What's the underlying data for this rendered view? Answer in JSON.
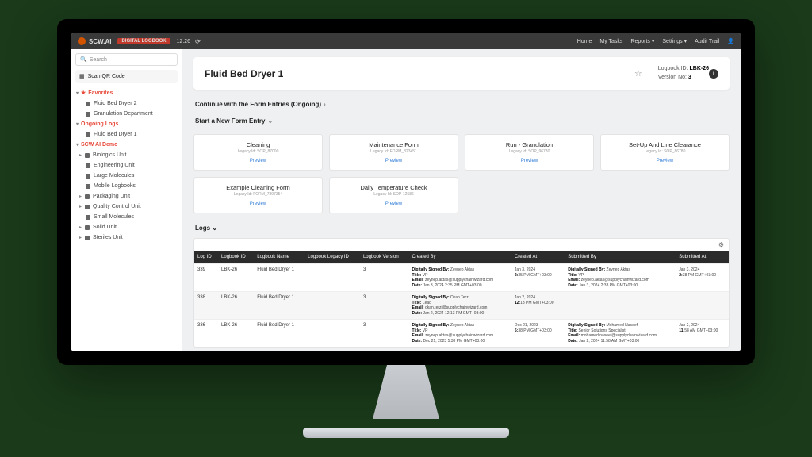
{
  "topbar": {
    "brand": "SCW.AI",
    "badge": "DIGITAL LOGBOOK",
    "time": "12:26",
    "nav": [
      "Home",
      "My Tasks",
      "Reports ▾",
      "Settings ▾",
      "Audit Trail"
    ]
  },
  "sidebar": {
    "search_ph": "Search",
    "qr": "Scan QR Code",
    "sections": [
      {
        "title": "Favorites",
        "items": [
          "Fluid Bed Dryer 2",
          "Granulation Department"
        ]
      },
      {
        "title": "Ongoing Logs",
        "items": [
          "Fluid Bed Dryer 1"
        ]
      },
      {
        "title": "SCW AI Demo",
        "items": []
      }
    ],
    "units": [
      "Biologics Unit",
      "Engineering Unit",
      "Large Molecules",
      "Mobile Logbooks",
      "Packaging Unit",
      "Quality Control Unit",
      "Small Molecules",
      "Solid Unit",
      "Steriles Unit"
    ]
  },
  "header": {
    "title": "Fluid Bed Dryer 1",
    "logbook_id_label": "Logbook ID:",
    "logbook_id": "LBK-26",
    "version_label": "Version No:",
    "version": "3"
  },
  "continue_label": "Continue with the Form Entries (Ongoing)",
  "start_label": "Start a New Form Entry",
  "forms": [
    {
      "t": "Cleaning",
      "s": "Legacy Id: SOP_87000",
      "p": "Preview"
    },
    {
      "t": "Maintenance Form",
      "s": "Legacy Id: FORM_823451",
      "p": "Preview"
    },
    {
      "t": "Run - Granulation",
      "s": "Legacy Id: SOP_96780",
      "p": "Preview"
    },
    {
      "t": "Set-Up And Line Clearance",
      "s": "Legacy Id: SOP_86780",
      "p": "Preview"
    },
    {
      "t": "Example Cleaning Form",
      "s": "Legacy Id: FORM_7897354",
      "p": "Preview"
    },
    {
      "t": "Daily Temperature Check",
      "s": "Legacy Id: SOP-12586",
      "p": "Preview"
    }
  ],
  "logs_label": "Logs",
  "table": {
    "cols": [
      "Log ID",
      "Logbook ID",
      "Logbook Name",
      "Logbook Legacy ID",
      "Logbook Version",
      "Created By",
      "Created At",
      "Submitted By",
      "Submitted At"
    ],
    "rows": [
      {
        "log_id": "339",
        "lbk": "LBK-26",
        "name": "Fluid Bed Dryer 1",
        "legacy": "",
        "ver": "3",
        "cby": "Digitally Signed By: Zeynep Aktas\nTitle: VP\nEmail: zeynep.aktas@supplychainwizard.com\nDate: Jan 3, 2024 2:35 PM GMT+03:00",
        "cat": "Jan 3, 2024\n2:35 PM GMT+03:00",
        "sby": "Digitally Signed By: Zeynep Aktas\nTitle: VP\nEmail: zeynep.aktas@supplychainwizard.com\nDate: Jan 3, 2024 2:38 PM GMT+03:00",
        "sat": "Jan 3, 2024\n2:38 PM GMT+03:00"
      },
      {
        "log_id": "338",
        "lbk": "LBK-26",
        "name": "Fluid Bed Dryer 1",
        "legacy": "",
        "ver": "3",
        "cby": "Digitally Signed By: Okan Terzi\nTitle: Lead\nEmail: okan.terzi@supplychainwizard.com\nDate: Jan 2, 2024 12:13 PM GMT+03:00",
        "cat": "Jan 2, 2024\n12:13 PM GMT+03:00",
        "sby": "",
        "sat": ""
      },
      {
        "log_id": "336",
        "lbk": "LBK-26",
        "name": "Fluid Bed Dryer 1",
        "legacy": "",
        "ver": "3",
        "cby": "Digitally Signed By: Zeynep Aktas\nTitle: VP\nEmail: zeynep.aktas@supplychainwizard.com\nDate: Dec 21, 2023 5:38 PM GMT+03:00",
        "cat": "Dec 21, 2023\n5:38 PM GMT+03:00",
        "sby": "Digitally Signed By: Mohamed Naseef\nTitle: Senior Solutions Specialist\nEmail: mohamed.naseef@supplychainwizard.com\nDate: Jan 2, 2024 11:58 AM GMT+03:00",
        "sat": "Jan 2, 2024\n11:58 AM GMT+03:00"
      }
    ]
  }
}
